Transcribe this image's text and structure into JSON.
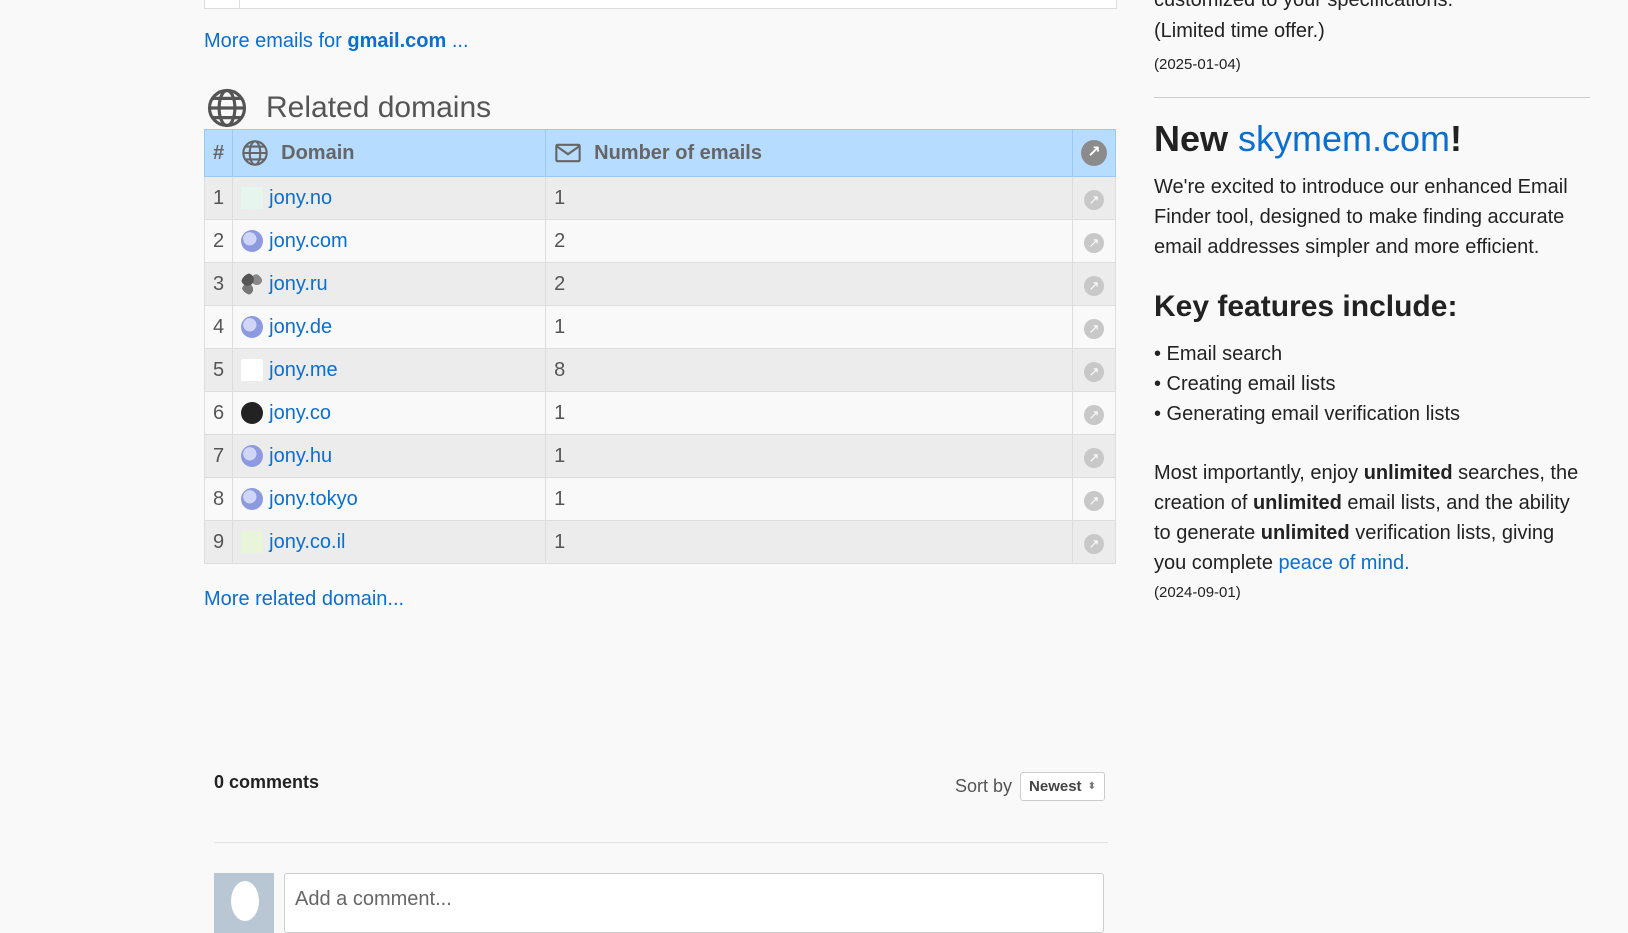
{
  "more_emails": {
    "prefix": "More emails for ",
    "domain": "gmail.com",
    "suffix": " ..."
  },
  "related": {
    "title": "Related domains",
    "headers": {
      "index": "#",
      "domain": "Domain",
      "emails": "Number of emails",
      "action": "↗"
    },
    "rows": [
      {
        "index": "1",
        "domain": "jony.no",
        "emails": "1",
        "icon": "jony-no-favicon"
      },
      {
        "index": "2",
        "domain": "jony.com",
        "emails": "2",
        "icon": "globe-favicon"
      },
      {
        "index": "3",
        "domain": "jony.ru",
        "emails": "2",
        "icon": "jony-ru-favicon"
      },
      {
        "index": "4",
        "domain": "jony.de",
        "emails": "1",
        "icon": "globe-favicon"
      },
      {
        "index": "5",
        "domain": "jony.me",
        "emails": "8",
        "icon": "jony-me-favicon"
      },
      {
        "index": "6",
        "domain": "jony.co",
        "emails": "1",
        "icon": "jony-co-favicon"
      },
      {
        "index": "7",
        "domain": "jony.hu",
        "emails": "1",
        "icon": "globe-favicon"
      },
      {
        "index": "8",
        "domain": "jony.tokyo",
        "emails": "1",
        "icon": "globe-favicon"
      },
      {
        "index": "9",
        "domain": "jony.co.il",
        "emails": "1",
        "icon": "jony-co-il-favicon"
      }
    ],
    "more_link": "More related domain..."
  },
  "comments": {
    "count_label": "0 comments",
    "sort_label": "Sort by",
    "sort_value": "Newest",
    "input_placeholder": "Add a comment..."
  },
  "sidebar": {
    "offer_cut": "customized to your specifications.",
    "offer_line": "(Limited time offer.)",
    "date1": "(2025-01-04)",
    "new_prefix": "New ",
    "new_link": "skymem.com",
    "new_suffix": "!",
    "intro": "We're excited to introduce our enhanced Email Finder tool, designed to make finding accurate email addresses simpler and more efficient.",
    "features_title": "Key features include:",
    "features": [
      "• Email search",
      "• Creating email lists",
      "• Generating email verification lists"
    ],
    "important": {
      "p1": "Most importantly, enjoy ",
      "b1": "unlimited",
      "p2": " searches, the creation of ",
      "b2": "unlimited",
      "p3": " email lists, and the ability to generate ",
      "b3": "unlimited",
      "p4": " verification lists, giving you complete ",
      "link": "peace of mind."
    },
    "date2": "(2024-09-01)"
  },
  "colors": {
    "link": "#0a6fd0",
    "table_header": "#b6dcff",
    "row_alt": "#ececec"
  }
}
